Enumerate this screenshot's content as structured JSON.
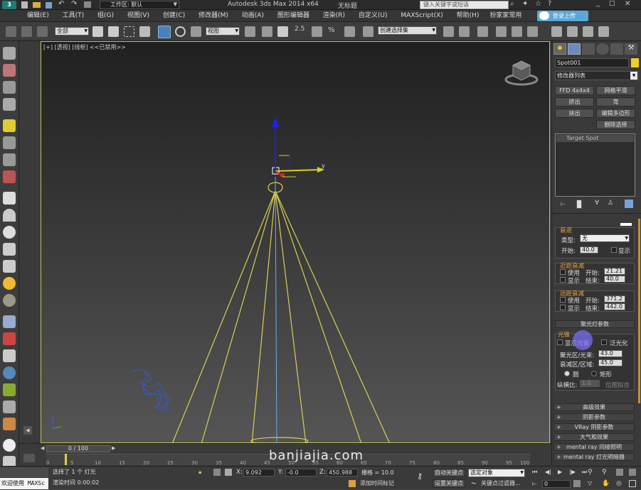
{
  "title_bar": {
    "workspace_label": "工作区: 默认",
    "app_title": "Autodesk 3ds Max  2014 x64",
    "doc_title": "无标题",
    "search_placeholder": "键入关键字或短语",
    "cloud_button": "登录上传"
  },
  "menus": [
    "编辑(E)",
    "工具(T)",
    "组(G)",
    "视图(V)",
    "创建(C)",
    "修改器(M)",
    "动画(A)",
    "图形编辑器",
    "渲染(R)",
    "自定义(U)",
    "MAXScript(X)",
    "帮助(H)",
    "扮家家常用"
  ],
  "main_toolbar": {
    "selection_filter": "全部",
    "ref_coord": "视图",
    "snap_value": "2.5",
    "named_selection": "创建选择集"
  },
  "viewport": {
    "label": "[+] [透视] [线框] <<已禁用>>",
    "axis_y": "y",
    "watermark": "banjiajia.com"
  },
  "command_panel": {
    "object_name": "Spot001",
    "object_color": "#f0d020",
    "modifier_list": "修改器列表",
    "mod_buttons": [
      [
        "FFD 4x4x4",
        "网格平滑"
      ],
      [
        "挤出",
        "弯"
      ],
      [
        "扶出",
        "编辑多边形"
      ],
      [
        "",
        "删除选择"
      ]
    ],
    "stack_item": "Target Spot",
    "decay": {
      "title": "衰退",
      "type_label": "类型:",
      "type_value": "无",
      "start_label": "开始:",
      "start_value": "40.0",
      "show_label": "显示"
    },
    "near_atten": {
      "title": "近距衰减",
      "use": "使用",
      "start_label": "开始:",
      "start_value": "21.21",
      "show": "显示",
      "end_label": "结束:",
      "end_value": "40.0"
    },
    "far_atten": {
      "title": "远距衰减",
      "use": "使用",
      "start_label": "开始:",
      "start_value": "371.2",
      "show": "显示",
      "end_label": "结束:",
      "end_value": "442.0"
    },
    "spot_params": {
      "title": "聚光灯参数",
      "cone_title": "光锥",
      "show_cone": "显示光锥",
      "overshoot": "泛光化",
      "hotspot_label": "聚光区/光束:",
      "hotspot_value": "43.0",
      "falloff_label": "衰减区/区域:",
      "falloff_value": "45.0",
      "circle": "圆",
      "rect": "矩形",
      "aspect_label": "纵横比:",
      "aspect_value": "1.0",
      "bitmap_fit": "位图拟合"
    },
    "rollouts": [
      "高级效果",
      "阴影参数",
      "VRay 阴影参数",
      "大气和效果",
      "mental ray 间接照明",
      "mental ray 灯光明暗器"
    ]
  },
  "timeline": {
    "frame_display": "0 / 100",
    "ticks": [
      "0",
      "5",
      "10",
      "15",
      "20",
      "25",
      "30",
      "35",
      "40",
      "45",
      "50",
      "55",
      "60",
      "65",
      "70",
      "75",
      "80",
      "85",
      "90",
      "95",
      "100"
    ]
  },
  "status_bar": {
    "welcome": "欢迎使用  MAXSc",
    "selected": "选择了 1 个 灯光",
    "render_time": "渲染时间  0:00:02",
    "x_label": "X:",
    "x_value": "9.092",
    "y_label": "Y:",
    "y_value": "-0.0",
    "z_label": "Z:",
    "z_value": "450.988",
    "grid": "栅格 = 10.0",
    "add_time_tag": "添加时间标记",
    "auto_key": "自动关键点",
    "set_key": "设置关键点",
    "selected_obj": "选定对象",
    "key_filters": "关键点过滤器...",
    "frame_field": "0"
  }
}
